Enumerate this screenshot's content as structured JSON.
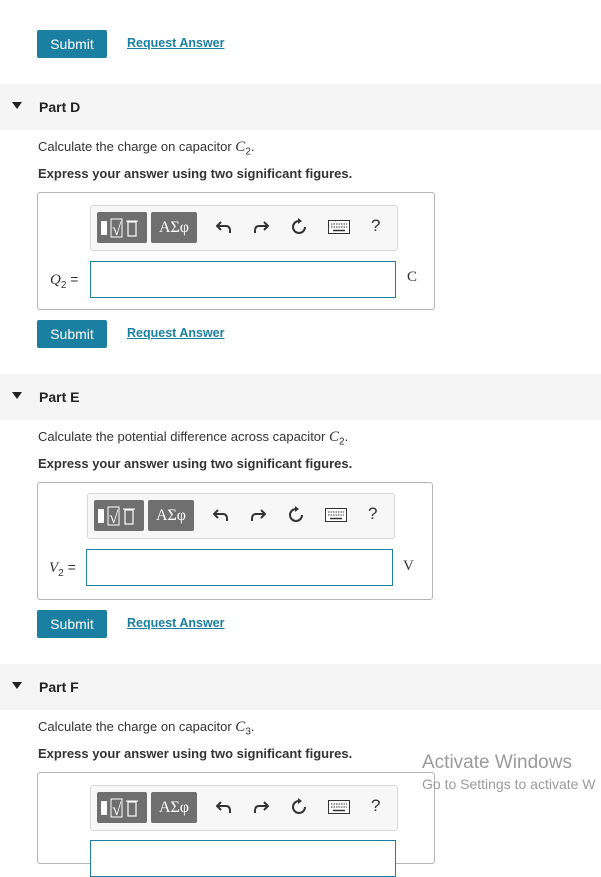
{
  "top": {
    "submit": "Submit",
    "request": "Request Answer"
  },
  "partD": {
    "title": "Part D",
    "question_prefix": "Calculate the charge on capacitor ",
    "question_var": "C",
    "question_sub": "2",
    "instruction": "Express your answer using two significant figures.",
    "var": "Q",
    "var_sub": "2",
    "equals": " =",
    "input_value": "",
    "unit": "C",
    "submit": "Submit",
    "request": "Request Answer"
  },
  "partE": {
    "title": "Part E",
    "question_prefix": "Calculate the potential difference across capacitor ",
    "question_var": "C",
    "question_sub": "2",
    "instruction": "Express your answer using two significant figures.",
    "var": "V",
    "var_sub": "2",
    "equals": " =",
    "input_value": "",
    "unit": "V",
    "submit": "Submit",
    "request": "Request Answer"
  },
  "partF": {
    "title": "Part F",
    "question_prefix": "Calculate the charge on capacitor ",
    "question_var": "C",
    "question_sub": "3",
    "instruction": "Express your answer using two significant figures."
  },
  "toolbar": {
    "greek": "ΑΣφ",
    "help": "?",
    "icons": [
      "template-icon",
      "greek-icon",
      "undo-icon",
      "redo-icon",
      "reset-icon",
      "keyboard-icon",
      "help-icon"
    ]
  },
  "watermark": {
    "line1": "Activate Windows",
    "line2": "Go to Settings to activate W"
  },
  "colors": {
    "accent": "#1a7fa0",
    "header_bg": "#f5f5f5",
    "toolbar_btn": "#6f6f6f"
  }
}
